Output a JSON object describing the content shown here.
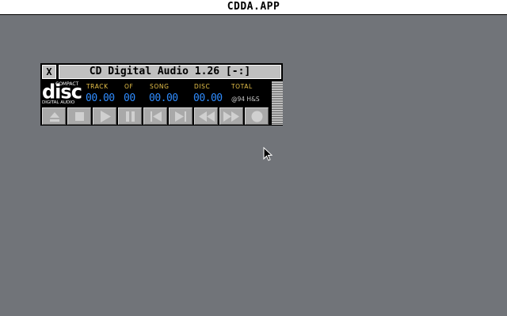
{
  "menubar": {
    "title": "CDDA.APP"
  },
  "window": {
    "close_glyph": "X",
    "title": "CD Digital Audio 1.26 [-:]"
  },
  "logo": {
    "top": "COMPACT",
    "main": "disc",
    "bottom": "DIGITAL AUDIO"
  },
  "display": {
    "labels": {
      "track": "TRACK",
      "of": "OF",
      "song": "SONG",
      "disc": "DISC",
      "total": "TOTAL"
    },
    "values": {
      "track": "00.00",
      "of": "00",
      "song": "00.00",
      "disc": "00.00"
    },
    "credit": "@94 H&S"
  },
  "buttons": [
    {
      "name": "eject",
      "icon": "eject-icon"
    },
    {
      "name": "stop",
      "icon": "stop-icon"
    },
    {
      "name": "play",
      "icon": "play-icon"
    },
    {
      "name": "pause",
      "icon": "pause-icon"
    },
    {
      "name": "previous",
      "icon": "previous-track-icon"
    },
    {
      "name": "next",
      "icon": "next-track-icon"
    },
    {
      "name": "rewind",
      "icon": "rewind-icon"
    },
    {
      "name": "fast-forward",
      "icon": "fast-forward-icon"
    },
    {
      "name": "record",
      "icon": "record-icon"
    }
  ],
  "colors": {
    "desktop": "#717479",
    "label": "#e8c24a",
    "digits": "#2f8cff",
    "button": "#a9a9a9",
    "button_icon": "#d0d0d0"
  }
}
